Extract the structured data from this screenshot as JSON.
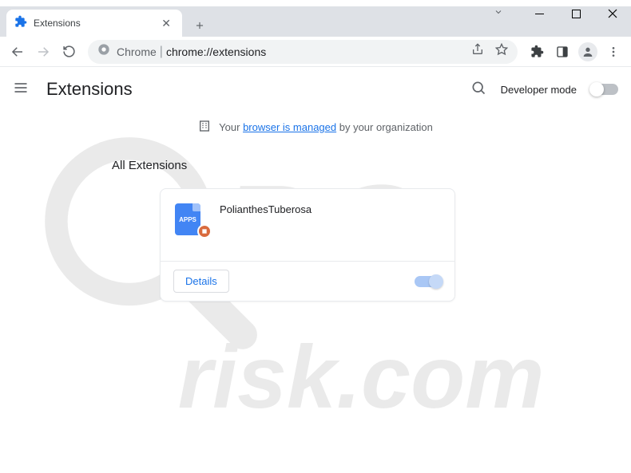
{
  "window": {
    "tab_label": "Extensions",
    "url_scheme": "Chrome",
    "url_path": "chrome://extensions"
  },
  "app": {
    "title": "Extensions",
    "dev_mode_label": "Developer mode",
    "dev_mode_on": false
  },
  "managed": {
    "prefix": "Your ",
    "link": "browser is managed",
    "suffix": " by your organization"
  },
  "section": {
    "title": "All Extensions"
  },
  "extension": {
    "name": "PolianthesTuberosa",
    "icon_text": "APPS",
    "details_label": "Details",
    "enabled": true
  }
}
